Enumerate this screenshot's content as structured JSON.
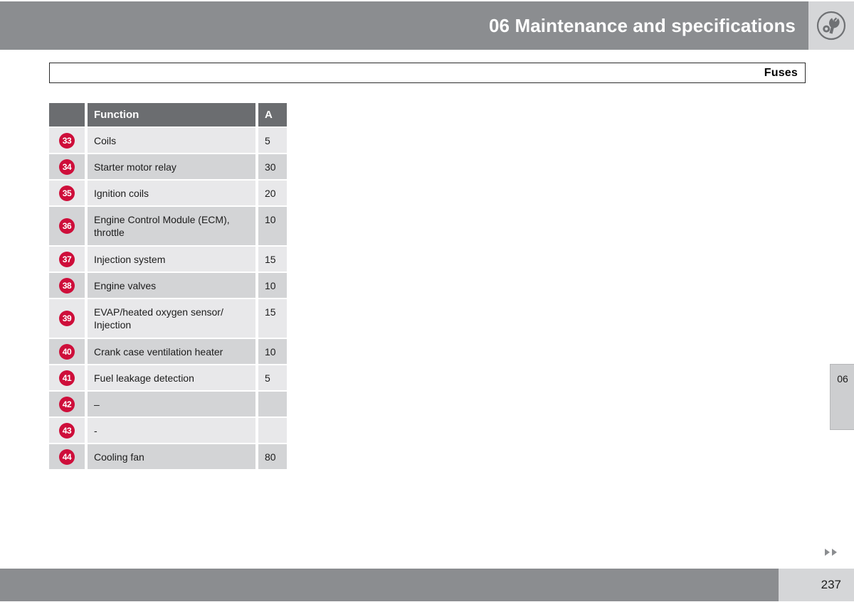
{
  "header": {
    "title": "06 Maintenance and specifications",
    "icon": "wrench-gear-icon"
  },
  "section": {
    "title": "Fuses"
  },
  "table": {
    "columns": {
      "number": "",
      "function": "Function",
      "amps": "A"
    },
    "rows": [
      {
        "number": "33",
        "function": "Coils",
        "amps": "5"
      },
      {
        "number": "34",
        "function": "Starter motor relay",
        "amps": "30"
      },
      {
        "number": "35",
        "function": "Ignition coils",
        "amps": "20"
      },
      {
        "number": "36",
        "function": "Engine Control Module (ECM), throttle",
        "amps": "10"
      },
      {
        "number": "37",
        "function": "Injection system",
        "amps": "15"
      },
      {
        "number": "38",
        "function": "Engine valves",
        "amps": "10"
      },
      {
        "number": "39",
        "function": "EVAP/heated oxygen sensor/ Injection",
        "amps": "15"
      },
      {
        "number": "40",
        "function": "Crank case ventilation heater",
        "amps": "10"
      },
      {
        "number": "41",
        "function": "Fuel leakage detection",
        "amps": "5"
      },
      {
        "number": "42",
        "function": "–",
        "amps": ""
      },
      {
        "number": "43",
        "function": "-",
        "amps": ""
      },
      {
        "number": "44",
        "function": "Cooling fan",
        "amps": "80"
      }
    ]
  },
  "side_tab": {
    "label": "06"
  },
  "footer": {
    "page_number": "237",
    "arrows": "double-right-arrow-icon"
  },
  "colors": {
    "header_bar": "#8b8d90",
    "header_icon_box": "#d5d6d8",
    "table_header": "#6b6d70",
    "row_odd": "#e8e8ea",
    "row_even": "#d3d4d6",
    "badge_red": "#ce0e3a",
    "side_tab": "#cdced0"
  }
}
